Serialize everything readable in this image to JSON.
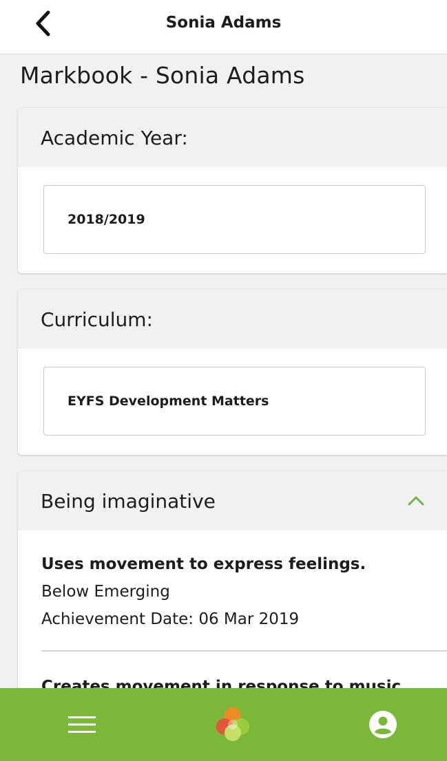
{
  "header": {
    "title": "Sonia Adams",
    "back_icon": "chevron-left-icon"
  },
  "page": {
    "title": "Markbook - Sonia Adams"
  },
  "academic_year": {
    "label": "Academic Year:",
    "value": "2018/2019"
  },
  "curriculum": {
    "label": "Curriculum:",
    "value": "EYFS Development Matters"
  },
  "section": {
    "title": "Being imaginative",
    "toggle_icon": "chevron-up-icon",
    "items": [
      {
        "title": "Uses movement to express feelings.",
        "level": "Below Emerging",
        "date": "Achievement Date: 06 Mar 2019"
      },
      {
        "title": "Creates movement in response to music."
      }
    ]
  },
  "bottom_nav": {
    "menu_icon": "hamburger-menu-icon",
    "home_icon": "app-logo-icon",
    "profile_icon": "account-circle-icon"
  },
  "colors": {
    "accent_green": "#7bb83a",
    "chevron_green": "#6cb33f",
    "logo_orange": "#f08a24",
    "logo_red": "#e94e3c",
    "logo_light_green": "#9ccc3c"
  }
}
